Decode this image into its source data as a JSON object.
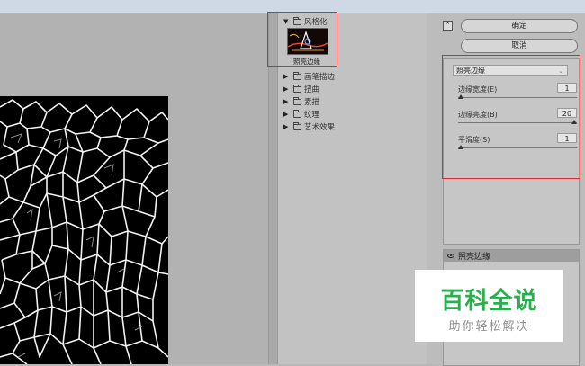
{
  "filter_gallery": {
    "stylize_category": "风格化",
    "selected_filter": "照亮边缘",
    "categories": [
      "画笔描边",
      "扭曲",
      "素描",
      "纹理",
      "艺术效果"
    ]
  },
  "buttons": {
    "ok": "确定",
    "cancel": "取消",
    "collapse": "⌃"
  },
  "settings": {
    "filter_select": "照亮边缘",
    "params": [
      {
        "label": "边缘宽度(E)",
        "value": "1",
        "fraction": 0.0
      },
      {
        "label": "边缘亮度(B)",
        "value": "20",
        "fraction": 1.0
      },
      {
        "label": "平滑度(S)",
        "value": "1",
        "fraction": 0.0
      }
    ]
  },
  "layers": {
    "current": "照亮边缘"
  },
  "watermark": {
    "main": "百科全说",
    "sub": "助你轻松解决"
  },
  "colors": {
    "highlight_outline": "#d92b2b",
    "watermark_green": "#28b04d"
  }
}
